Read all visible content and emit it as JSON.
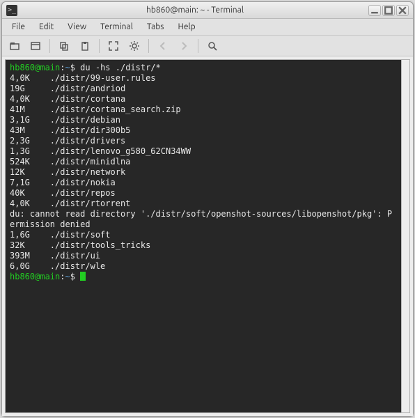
{
  "window": {
    "title": "hb860@main: ~ - Terminal",
    "icon_glyph": ">_"
  },
  "menubar": [
    "File",
    "Edit",
    "View",
    "Terminal",
    "Tabs",
    "Help"
  ],
  "toolbar": {
    "items": [
      {
        "name": "new-tab",
        "glyph": "tab"
      },
      {
        "name": "new-window",
        "glyph": "window"
      },
      {
        "name": "copy",
        "glyph": "copy"
      },
      {
        "name": "paste",
        "glyph": "paste"
      },
      {
        "name": "fullscreen",
        "glyph": "full"
      },
      {
        "name": "settings",
        "glyph": "gear"
      },
      {
        "name": "prev-tab",
        "glyph": "left",
        "disabled": true
      },
      {
        "name": "next-tab",
        "glyph": "right",
        "disabled": true
      },
      {
        "name": "search",
        "glyph": "search"
      }
    ]
  },
  "terminal": {
    "prompt_user": "hb860@main",
    "prompt_sep": ":",
    "prompt_path": "~",
    "prompt_sym": "$",
    "command": "du -hs ./distr/*",
    "output": [
      {
        "size": "4,0K",
        "path": "./distr/99-user.rules"
      },
      {
        "size": "19G",
        "path": "./distr/andriod"
      },
      {
        "size": "4,0K",
        "path": "./distr/cortana"
      },
      {
        "size": "41M",
        "path": "./distr/cortana_search.zip"
      },
      {
        "size": "3,1G",
        "path": "./distr/debian"
      },
      {
        "size": "43M",
        "path": "./distr/dir300b5"
      },
      {
        "size": "2,3G",
        "path": "./distr/drivers"
      },
      {
        "size": "1,3G",
        "path": "./distr/lenovo_g580_62CN34WW"
      },
      {
        "size": "524K",
        "path": "./distr/minidlna"
      },
      {
        "size": "12K",
        "path": "./distr/network"
      },
      {
        "size": "7,1G",
        "path": "./distr/nokia"
      },
      {
        "size": "40K",
        "path": "./distr/repos"
      },
      {
        "size": "4,0K",
        "path": "./distr/rtorrent"
      }
    ],
    "error_line": "du: cannot read directory './distr/soft/openshot-sources/libopenshot/pkg': Permission denied",
    "output2": [
      {
        "size": "1,6G",
        "path": "./distr/soft"
      },
      {
        "size": "32K",
        "path": "./distr/tools_tricks"
      },
      {
        "size": "393M",
        "path": "./distr/ui"
      },
      {
        "size": "6,0G",
        "path": "./distr/wle"
      }
    ],
    "tab_width": 8
  }
}
